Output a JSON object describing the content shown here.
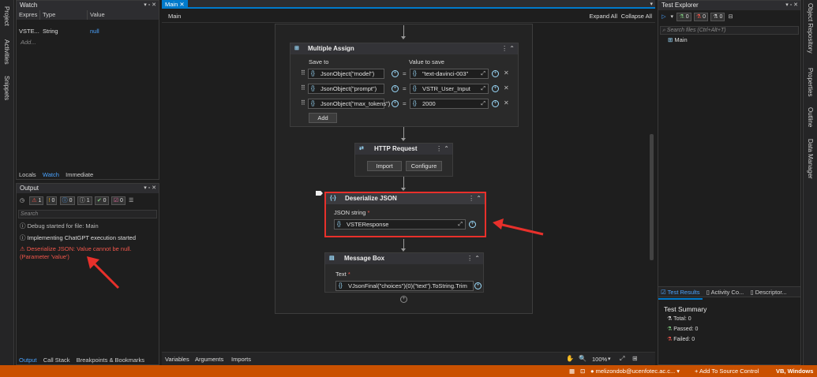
{
  "left_strip": {
    "items": [
      "Project",
      "Activities",
      "Snippets"
    ]
  },
  "right_strip": {
    "items": [
      "Object Repository",
      "Properties",
      "Outline",
      "Data Manager"
    ]
  },
  "watch": {
    "title": "Watch",
    "columns": [
      "Expres",
      "Type",
      "Value"
    ],
    "rows": [
      {
        "expr": "VSTE...",
        "type": "String",
        "value": "null"
      }
    ],
    "add_placeholder": "Add...",
    "tabs": [
      "Locals",
      "Watch",
      "Immediate"
    ]
  },
  "output": {
    "title": "Output",
    "counts": {
      "error": "1",
      "warn": "0",
      "info": "0",
      "trace": "1",
      "verbose": "0",
      "other": "0"
    },
    "search_placeholder": "Search",
    "lines": [
      "Debug started for file: Main",
      "Implementing ChatGPT execution started",
      "Deserialize JSON: Value cannot be null. (Parameter 'value')"
    ],
    "tabs": [
      "Output",
      "Call Stack",
      "Breakpoints & Bookmarks"
    ]
  },
  "designer": {
    "doc_tab": "Main",
    "breadcrumb": "Main",
    "expand_all": "Expand All",
    "collapse_all": "Collapse All",
    "multiple_assign": {
      "title": "Multiple Assign",
      "col_save": "Save to",
      "col_value": "Value to save",
      "rows": [
        {
          "to": "JsonObject(\"model\")",
          "value": "\"text-davinci-003\""
        },
        {
          "to": "JsonObject(\"prompt\")",
          "value": "VSTR_User_Input"
        },
        {
          "to": "JsonObject(\"max_tokens\")",
          "value": "2000"
        }
      ],
      "add": "Add"
    },
    "http": {
      "title": "HTTP Request",
      "import": "Import",
      "configure": "Configure"
    },
    "deserialize": {
      "title": "Deserialize JSON",
      "label": "JSON string",
      "value": "VSTEResponse"
    },
    "message_box": {
      "title": "Message Box",
      "label": "Text",
      "value": "VJsonFinal(\"choices\")(0)(\"text\").ToString.Trim"
    },
    "bottom_tabs": [
      "Variables",
      "Arguments",
      "Imports"
    ],
    "zoom": "100%"
  },
  "test_explorer": {
    "title": "Test Explorer",
    "counts": [
      "0",
      "0",
      "0"
    ],
    "search_placeholder": "Search files (Ctrl+Alt+T)",
    "tree_item": "Main",
    "tabs": [
      "Test Results",
      "Activity Co...",
      "Descriptor..."
    ],
    "summary_title": "Test Summary",
    "total": "Total: 0",
    "passed": "Passed: 0",
    "failed": "Failed: 0"
  },
  "status_bar": {
    "user": "melizondob@ucenfotec.ac.c...",
    "source_control": "+ Add To Source Control",
    "mode": "VB, Windows"
  },
  "colors": {
    "accent": "#007acc",
    "status": "#ca5100",
    "highlight": "#e8302b",
    "error": "#f0564b"
  }
}
